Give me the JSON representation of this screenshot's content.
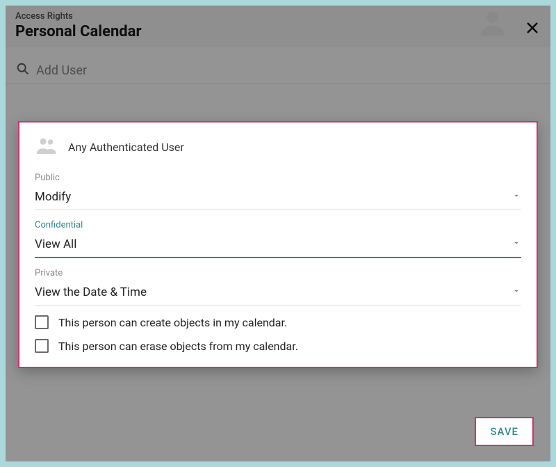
{
  "header": {
    "subtitle": "Access Rights",
    "title": "Personal Calendar"
  },
  "search": {
    "placeholder": "Add User"
  },
  "panel": {
    "user_label": "Any Authenticated User",
    "fields": {
      "public": {
        "label": "Public",
        "value": "Modify"
      },
      "confidential": {
        "label": "Confidential",
        "value": "View All"
      },
      "private": {
        "label": "Private",
        "value": "View the Date & Time"
      }
    },
    "checkboxes": {
      "create": "This person can create objects in my calendar.",
      "erase": "This person can erase objects from my calendar."
    }
  },
  "actions": {
    "save": "SAVE"
  }
}
